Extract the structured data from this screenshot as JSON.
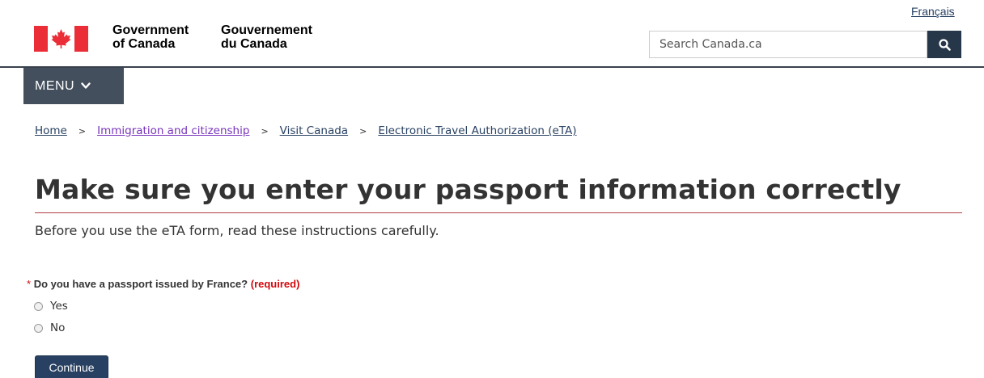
{
  "header": {
    "language_toggle": "Français",
    "wordmark": {
      "en_line1": "Government",
      "en_line2": "of Canada",
      "fr_line1": "Gouvernement",
      "fr_line2": "du Canada"
    },
    "search": {
      "placeholder": "Search Canada.ca",
      "button_icon": "search-icon"
    },
    "menu_label": "MENU"
  },
  "breadcrumb": {
    "items": [
      {
        "label": "Home"
      },
      {
        "label": "Immigration and citizenship"
      },
      {
        "label": "Visit Canada"
      },
      {
        "label": "Electronic Travel Authorization (eTA)"
      }
    ],
    "separator": ">"
  },
  "main": {
    "title": "Make sure you enter your passport information correctly",
    "intro": "Before you use the eTA form, read these instructions carefully.",
    "question": {
      "required_marker": "*",
      "text": "Do you have a passport issued by France?",
      "required_label": "(required)",
      "options": [
        {
          "label": "Yes"
        },
        {
          "label": "No"
        }
      ]
    },
    "continue_label": "Continue"
  },
  "colors": {
    "flag_red": "#eb2d37",
    "nav_dark": "#444f5e",
    "button_blue": "#284162",
    "required_red": "#d3080c",
    "visited_link": "#7834bc"
  }
}
